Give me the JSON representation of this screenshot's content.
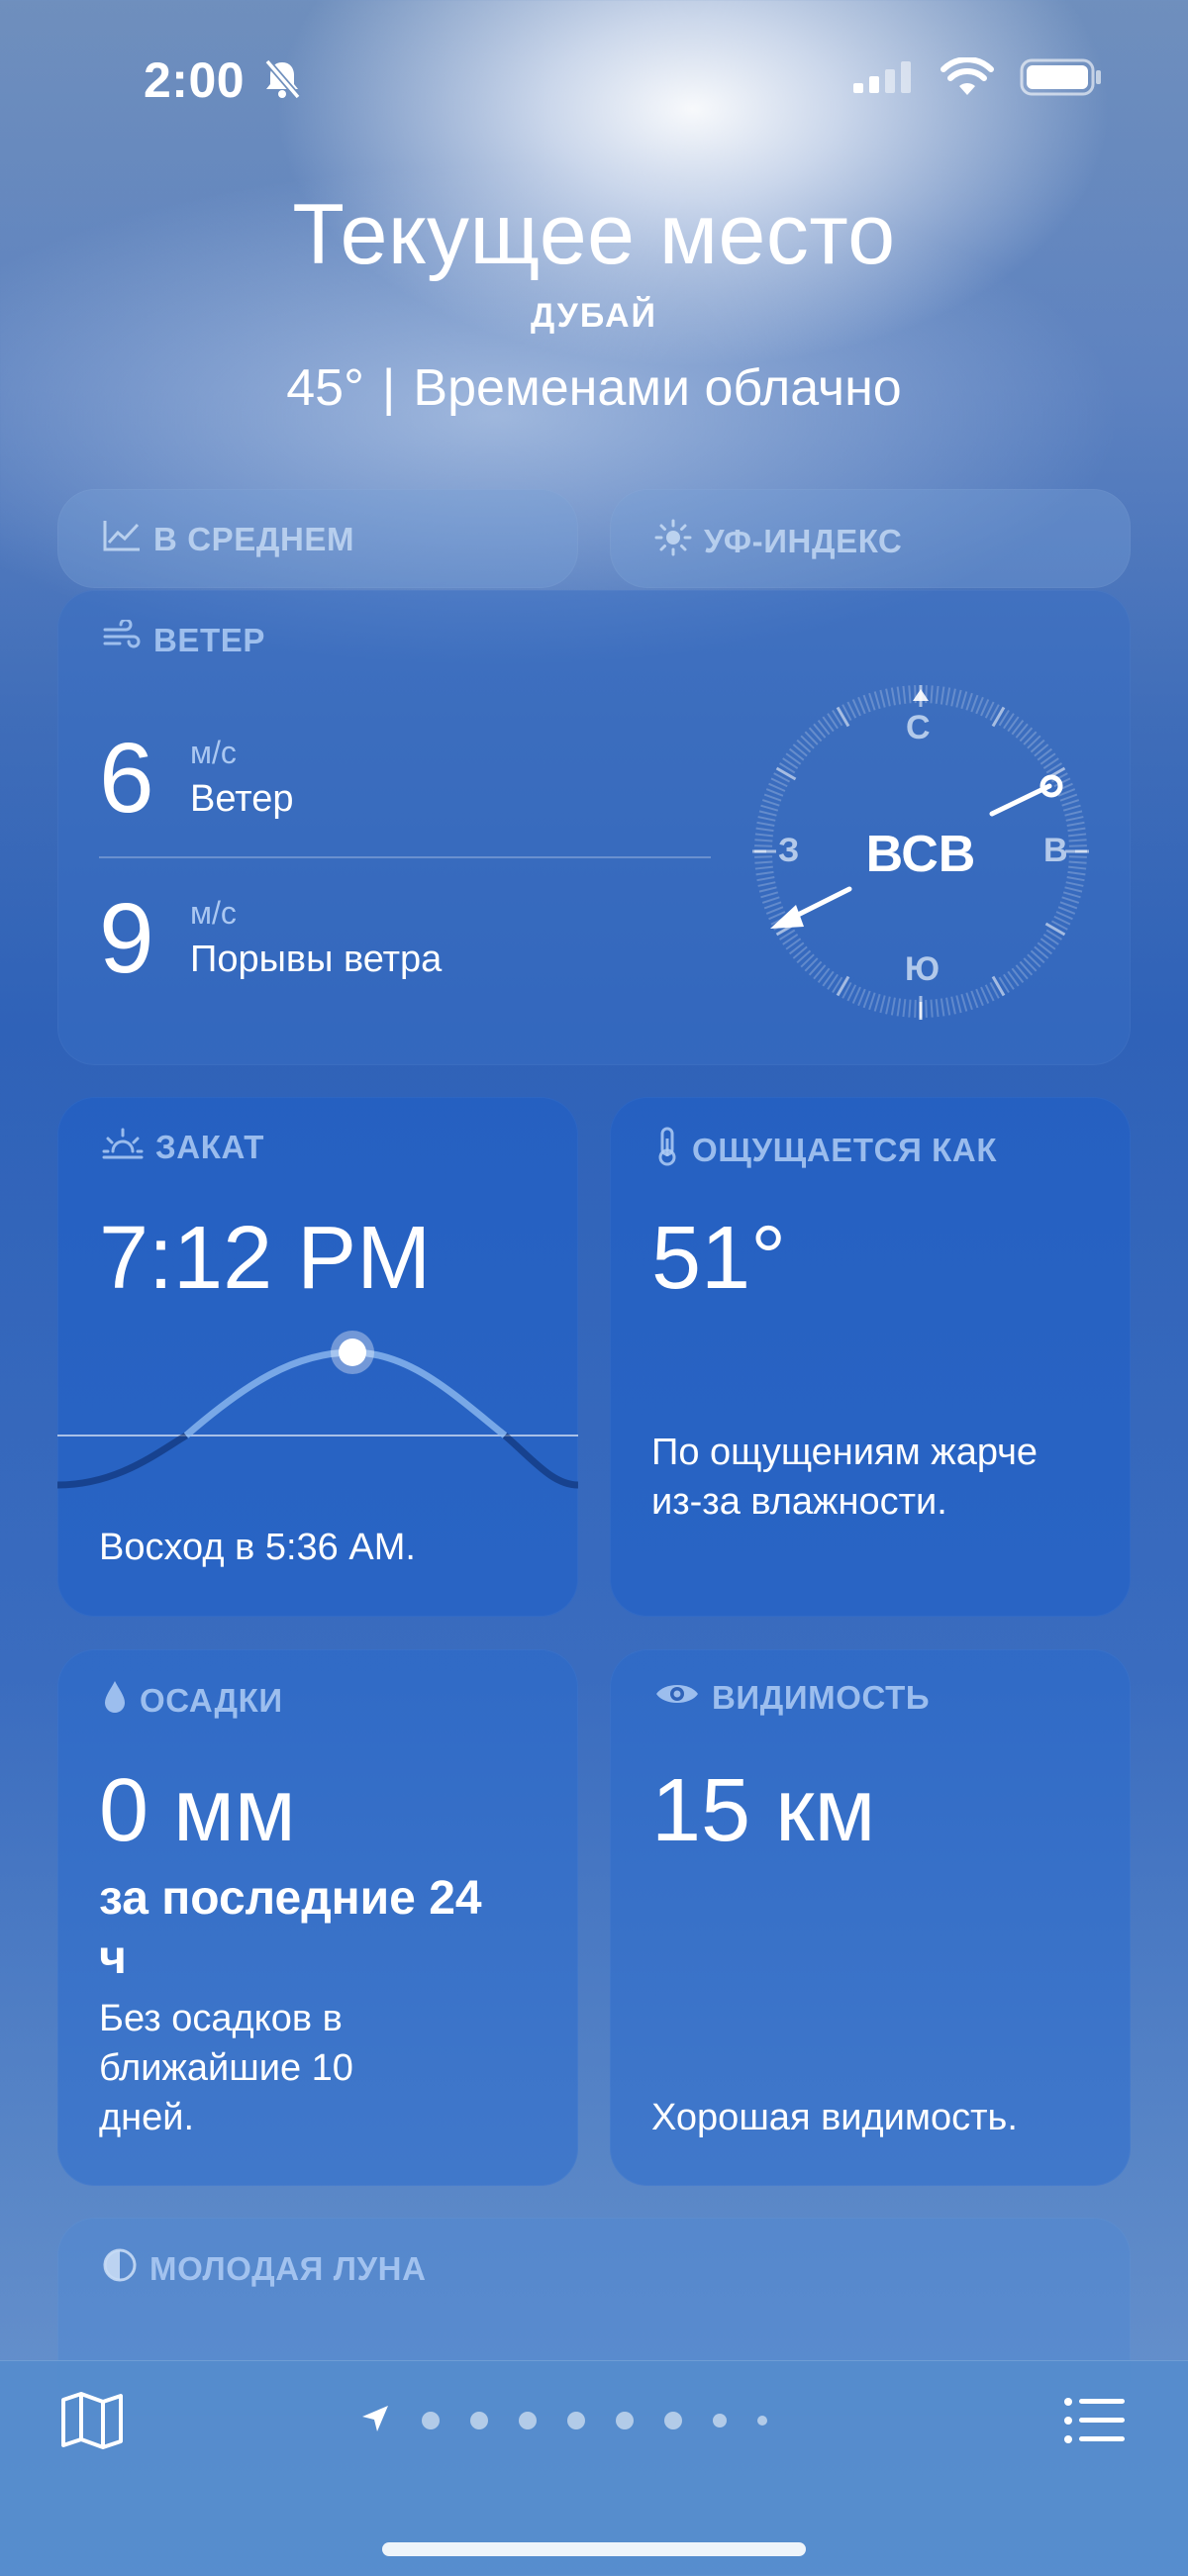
{
  "status_bar": {
    "time": "2:00"
  },
  "header": {
    "title": "Текущее место",
    "city": "ДУБАЙ",
    "temperature": "45°",
    "separator": "|",
    "condition": "Временами облачно"
  },
  "top_cards": {
    "average_label": "В СРЕДНЕМ",
    "uv_label": "УФ-ИНДЕКС"
  },
  "wind": {
    "label": "ВЕТЕР",
    "speed": "6",
    "speed_unit": "м/с",
    "speed_label": "Ветер",
    "gust": "9",
    "gust_unit": "м/с",
    "gust_label": "Порывы ветра",
    "direction": "ВСВ",
    "compass": {
      "n": "С",
      "e": "В",
      "s": "Ю",
      "w": "З"
    }
  },
  "sunset": {
    "label": "ЗАКАТ",
    "time": "7:12 PM",
    "sunrise_text": "Восход в 5:36 AM."
  },
  "feels_like": {
    "label": "ОЩУЩАЕТСЯ КАК",
    "value": "51°",
    "description": "По ощущениям жарче из-за влажности."
  },
  "precipitation": {
    "label": "ОСАДКИ",
    "value": "0 мм",
    "period": "за последние 24 ч",
    "description": "Без осадков в ближайшие 10 дней."
  },
  "visibility": {
    "label": "ВИДИМОСТЬ",
    "value": "15 км",
    "description": "Хорошая видимость."
  },
  "moon": {
    "label": "МОЛОДАЯ ЛУНА"
  },
  "bottom_bar": {
    "page_count": 9,
    "current_page": 0
  }
}
